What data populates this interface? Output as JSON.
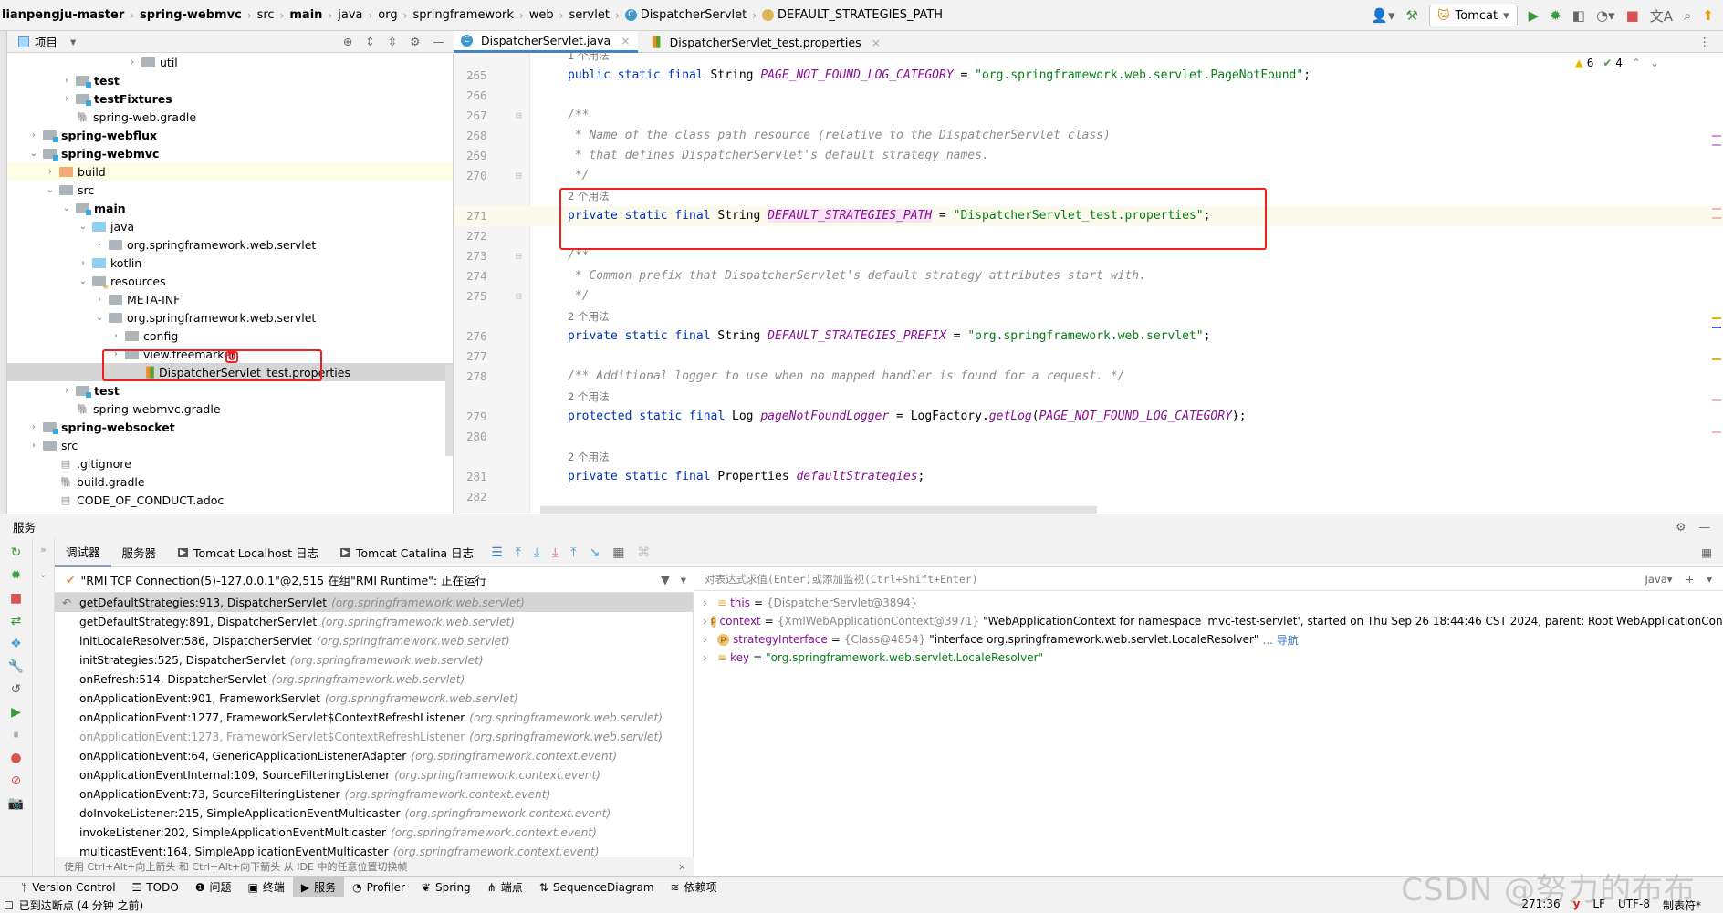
{
  "breadcrumb": [
    "lianpengju-master",
    "spring-webmvc",
    "src",
    "main",
    "java",
    "org",
    "springframework",
    "web",
    "servlet",
    "DispatcherServlet",
    "DEFAULT_STRATEGIES_PATH"
  ],
  "toolbar": {
    "run_config": "Tomcat",
    "icons": [
      "user-icon",
      "build-hammer-icon",
      "run-icon",
      "debug-icon",
      "coverage-icon",
      "profile-icon",
      "stop-icon",
      "translate-icon",
      "search-icon",
      "update-icon"
    ]
  },
  "project": {
    "title": "项目",
    "tree": [
      {
        "label": "util",
        "level": 6,
        "arrow": "›",
        "kind": "folder",
        "bold": false
      },
      {
        "label": "test",
        "level": 2,
        "arrow": "›",
        "kind": "mod",
        "bold": true
      },
      {
        "label": "testFixtures",
        "level": 2,
        "arrow": "›",
        "kind": "mod",
        "bold": true
      },
      {
        "label": "spring-web.gradle",
        "level": 2,
        "arrow": "",
        "kind": "gradle",
        "bold": false
      },
      {
        "label": "spring-webflux",
        "level": 0,
        "arrow": "›",
        "kind": "mod",
        "bold": true
      },
      {
        "label": "spring-webmvc",
        "level": 0,
        "arrow": "⌄",
        "kind": "mod",
        "bold": true
      },
      {
        "label": "build",
        "level": 1,
        "arrow": "›",
        "kind": "build",
        "bold": false,
        "state": "hl"
      },
      {
        "label": "src",
        "level": 1,
        "arrow": "⌄",
        "kind": "folder",
        "bold": false
      },
      {
        "label": "main",
        "level": 2,
        "arrow": "⌄",
        "kind": "mod",
        "bold": true
      },
      {
        "label": "java",
        "level": 3,
        "arrow": "⌄",
        "kind": "src",
        "bold": false
      },
      {
        "label": "org.springframework.web.servlet",
        "level": 4,
        "arrow": "›",
        "kind": "pkg",
        "bold": false
      },
      {
        "label": "kotlin",
        "level": 3,
        "arrow": "›",
        "kind": "src",
        "bold": false
      },
      {
        "label": "resources",
        "level": 3,
        "arrow": "⌄",
        "kind": "res",
        "bold": false
      },
      {
        "label": "META-INF",
        "level": 4,
        "arrow": "›",
        "kind": "folder",
        "bold": false
      },
      {
        "label": "org.springframework.web.servlet",
        "level": 4,
        "arrow": "⌄",
        "kind": "folder",
        "bold": false
      },
      {
        "label": "config",
        "level": 5,
        "arrow": "›",
        "kind": "folder",
        "bold": false
      },
      {
        "label": "view.freemarker",
        "level": 5,
        "arrow": "›",
        "kind": "folder",
        "bold": false
      },
      {
        "label": "DispatcherServlet_test.properties",
        "level": 6,
        "arrow": "",
        "kind": "props",
        "bold": false,
        "state": "sel"
      },
      {
        "label": "test",
        "level": 2,
        "arrow": "›",
        "kind": "mod",
        "bold": true
      },
      {
        "label": "spring-webmvc.gradle",
        "level": 2,
        "arrow": "",
        "kind": "gradle",
        "bold": false
      },
      {
        "label": "spring-websocket",
        "level": 0,
        "arrow": "›",
        "kind": "mod",
        "bold": true
      },
      {
        "label": "src",
        "level": 0,
        "arrow": "›",
        "kind": "folder",
        "bold": false
      },
      {
        "label": ".gitignore",
        "level": 1,
        "arrow": "",
        "kind": "file",
        "bold": false
      },
      {
        "label": "build.gradle",
        "level": 1,
        "arrow": "",
        "kind": "gradle",
        "bold": false
      },
      {
        "label": "CODE_OF_CONDUCT.adoc",
        "level": 1,
        "arrow": "",
        "kind": "file",
        "bold": false
      }
    ],
    "annotation_marker": "0"
  },
  "editor": {
    "tabs": [
      {
        "label": "DispatcherServlet.java",
        "active": true
      },
      {
        "label": "DispatcherServlet_test.properties",
        "active": false
      }
    ],
    "warnings": "6",
    "checks": "4",
    "lines": [
      {
        "hint": "1 个用法"
      },
      {
        "n": "265",
        "tokens": [
          [
            "kw",
            "public static final "
          ],
          [
            "ty",
            "String "
          ],
          [
            "cn",
            "PAGE_NOT_FOUND_LOG_CATEGORY"
          ],
          [
            "pl",
            " = "
          ],
          [
            "st",
            "\"org.springframework.web.servlet.PageNotFound\""
          ],
          [
            "pl",
            ";"
          ]
        ]
      },
      {
        "n": "266",
        "tokens": []
      },
      {
        "n": "267",
        "tokens": [
          [
            "cm",
            "/**"
          ]
        ]
      },
      {
        "n": "268",
        "tokens": [
          [
            "cm",
            " * Name of the class path resource (relative to the DispatcherServlet class)"
          ]
        ]
      },
      {
        "n": "269",
        "tokens": [
          [
            "cm",
            " * that defines DispatcherServlet's default strategy names."
          ]
        ]
      },
      {
        "n": "270",
        "tokens": [
          [
            "cm",
            " */"
          ]
        ]
      },
      {
        "hint": "2 个用法"
      },
      {
        "n": "271",
        "current": true,
        "tokens": [
          [
            "kw",
            "private static final "
          ],
          [
            "ty",
            "String "
          ],
          [
            "cnh",
            "DEFAULT_STRATEGIES_PATH"
          ],
          [
            "pl",
            " = "
          ],
          [
            "st",
            "\"DispatcherServlet_test.properties\""
          ],
          [
            "pl",
            ";"
          ]
        ]
      },
      {
        "n": "272",
        "tokens": []
      },
      {
        "n": "273",
        "tokens": [
          [
            "cm",
            "/**"
          ]
        ]
      },
      {
        "n": "274",
        "tokens": [
          [
            "cm",
            " * Common prefix that DispatcherServlet's default strategy attributes start with."
          ]
        ]
      },
      {
        "n": "275",
        "tokens": [
          [
            "cm",
            " */"
          ]
        ]
      },
      {
        "hint": "2 个用法"
      },
      {
        "n": "276",
        "tokens": [
          [
            "kw",
            "private static final "
          ],
          [
            "ty",
            "String "
          ],
          [
            "cn",
            "DEFAULT_STRATEGIES_PREFIX"
          ],
          [
            "pl",
            " = "
          ],
          [
            "st",
            "\"org.springframework.web.servlet\""
          ],
          [
            "pl",
            ";"
          ]
        ]
      },
      {
        "n": "277",
        "tokens": []
      },
      {
        "n": "278",
        "tokens": [
          [
            "cm",
            "/** Additional logger to use when no mapped handler is found for a request. */"
          ]
        ]
      },
      {
        "hint": "2 个用法"
      },
      {
        "n": "279",
        "tokens": [
          [
            "kw",
            "protected static final "
          ],
          [
            "ty",
            "Log "
          ],
          [
            "cn",
            "pageNotFoundLogger"
          ],
          [
            "pl",
            " = LogFactory."
          ],
          [
            "cn",
            "getLog"
          ],
          [
            "pl",
            "("
          ],
          [
            "cn",
            "PAGE_NOT_FOUND_LOG_CATEGORY"
          ],
          [
            "pl",
            ");"
          ]
        ]
      },
      {
        "n": "280",
        "tokens": []
      },
      {
        "hint": "2 个用法"
      },
      {
        "n": "281",
        "tokens": [
          [
            "kw",
            "private static final "
          ],
          [
            "ty",
            "Properties "
          ],
          [
            "cn",
            "defaultStrategies"
          ],
          [
            "pl",
            ";"
          ]
        ]
      },
      {
        "n": "282",
        "tokens": []
      }
    ]
  },
  "services": {
    "title": "服务",
    "tabs": [
      "调试器",
      "服务器",
      "Tomcat Localhost 日志",
      "Tomcat Catalina 日志"
    ],
    "thread": "\"RMI TCP Connection(5)-127.0.0.1\"@2,515 在组\"RMI Runtime\": 正在运行",
    "frames": [
      {
        "m": "getDefaultStrategies:913, DispatcherServlet",
        "p": "(org.springframework.web.servlet)",
        "state": "sel"
      },
      {
        "m": "getDefaultStrategy:891, DispatcherServlet",
        "p": "(org.springframework.web.servlet)"
      },
      {
        "m": "initLocaleResolver:586, DispatcherServlet",
        "p": "(org.springframework.web.servlet)"
      },
      {
        "m": "initStrategies:525, DispatcherServlet",
        "p": "(org.springframework.web.servlet)"
      },
      {
        "m": "onRefresh:514, DispatcherServlet",
        "p": "(org.springframework.web.servlet)"
      },
      {
        "m": "onApplicationEvent:901, FrameworkServlet",
        "p": "(org.springframework.web.servlet)"
      },
      {
        "m": "onApplicationEvent:1277, FrameworkServlet$ContextRefreshListener",
        "p": "(org.springframework.web.servlet)"
      },
      {
        "m": "onApplicationEvent:1273, FrameworkServlet$ContextRefreshListener",
        "p": "(org.springframework.web.servlet)",
        "state": "dim"
      },
      {
        "m": "onApplicationEvent:64, GenericApplicationListenerAdapter",
        "p": "(org.springframework.context.event)"
      },
      {
        "m": "onApplicationEventInternal:109, SourceFilteringListener",
        "p": "(org.springframework.context.event)"
      },
      {
        "m": "onApplicationEvent:73, SourceFilteringListener",
        "p": "(org.springframework.context.event)"
      },
      {
        "m": "doInvokeListener:215, SimpleApplicationEventMulticaster",
        "p": "(org.springframework.context.event)"
      },
      {
        "m": "invokeListener:202, SimpleApplicationEventMulticaster",
        "p": "(org.springframework.context.event)"
      },
      {
        "m": "multicastEvent:164, SimpleApplicationEventMulticaster",
        "p": "(org.springframework.context.event)"
      }
    ],
    "frames_hint": "使用 Ctrl+Alt+向上箭头 和 Ctrl+Alt+向下箭头 从 IDE 中的任意位置切换帧",
    "eval_placeholder": "对表达式求值(Enter)或添加监视(Ctrl+Shift+Enter)",
    "lang": "Java",
    "vars": [
      {
        "icon": "field",
        "name": "this",
        "type": "{DispatcherServlet@3894}",
        "value": ""
      },
      {
        "icon": "p",
        "name": "context",
        "type": "{XmlWebApplicationContext@3971}",
        "value": "\"WebApplicationContext for namespace 'mvc-test-servlet', started on Thu Sep 26 18:44:46 CST 2024, parent: Root WebApplicationContext\""
      },
      {
        "icon": "p",
        "name": "strategyInterface",
        "type": "{Class@4854}",
        "value": "\"interface org.springframework.web.servlet.LocaleResolver\"",
        "link": "... 导航"
      },
      {
        "icon": "field",
        "name": "key",
        "type": "",
        "value": "\"org.springframework.web.servlet.LocaleResolver\"",
        "str": true
      }
    ]
  },
  "toolwindows": [
    {
      "label": "Version Control",
      "icon": "ᛘ"
    },
    {
      "label": "TODO",
      "icon": "☰"
    },
    {
      "label": "问题",
      "icon": "❶"
    },
    {
      "label": "终端",
      "icon": "▣"
    },
    {
      "label": "服务",
      "icon": "▶",
      "active": true
    },
    {
      "label": "Profiler",
      "icon": "◔"
    },
    {
      "label": "Spring",
      "icon": "❦"
    },
    {
      "label": "端点",
      "icon": "⋔"
    },
    {
      "label": "SequenceDiagram",
      "icon": "⇅"
    },
    {
      "label": "依赖项",
      "icon": "≋"
    }
  ],
  "status": {
    "message": "已到达断点 (4 分钟 之前)",
    "position": "271:36",
    "line_sep": "LF",
    "encoding": "UTF-8",
    "indent": "制表符*"
  },
  "watermark": "CSDN @努力的布布",
  "colors": {
    "accent": "#4083c9",
    "highlight_box": "#ef2020",
    "string": "#067d17",
    "keyword": "#0033b3",
    "constant": "#871094"
  }
}
